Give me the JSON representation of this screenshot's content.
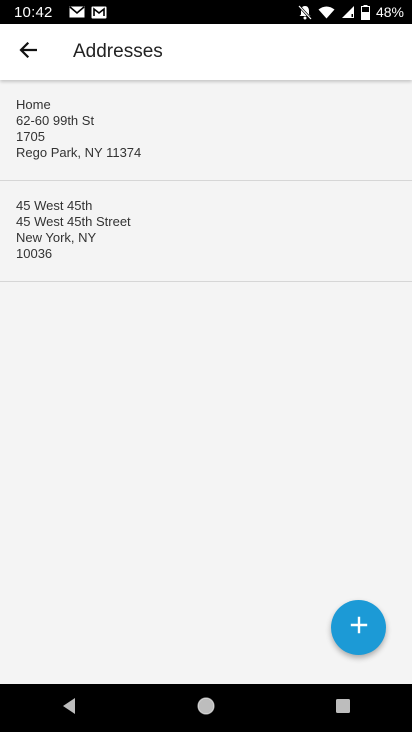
{
  "status_bar": {
    "time": "10:42",
    "battery": "48%",
    "icons": [
      "gmail-icon",
      "gmail-icon",
      "notifications-off-icon",
      "wifi-icon",
      "signal-icon",
      "battery-icon"
    ]
  },
  "app_bar": {
    "back_icon": "arrow-back-icon",
    "title": "Addresses"
  },
  "addresses": [
    {
      "lines": [
        "Home",
        "62-60 99th St",
        "1705",
        "Rego Park, NY 11374"
      ]
    },
    {
      "lines": [
        "45 West 45th",
        "45 West 45th Street",
        "New York, NY",
        "10036"
      ]
    }
  ],
  "fab": {
    "icon": "plus-icon",
    "color": "#1c9ad6"
  },
  "nav_bar": {
    "icons": [
      "back-triangle-icon",
      "home-circle-icon",
      "recents-square-icon"
    ]
  }
}
